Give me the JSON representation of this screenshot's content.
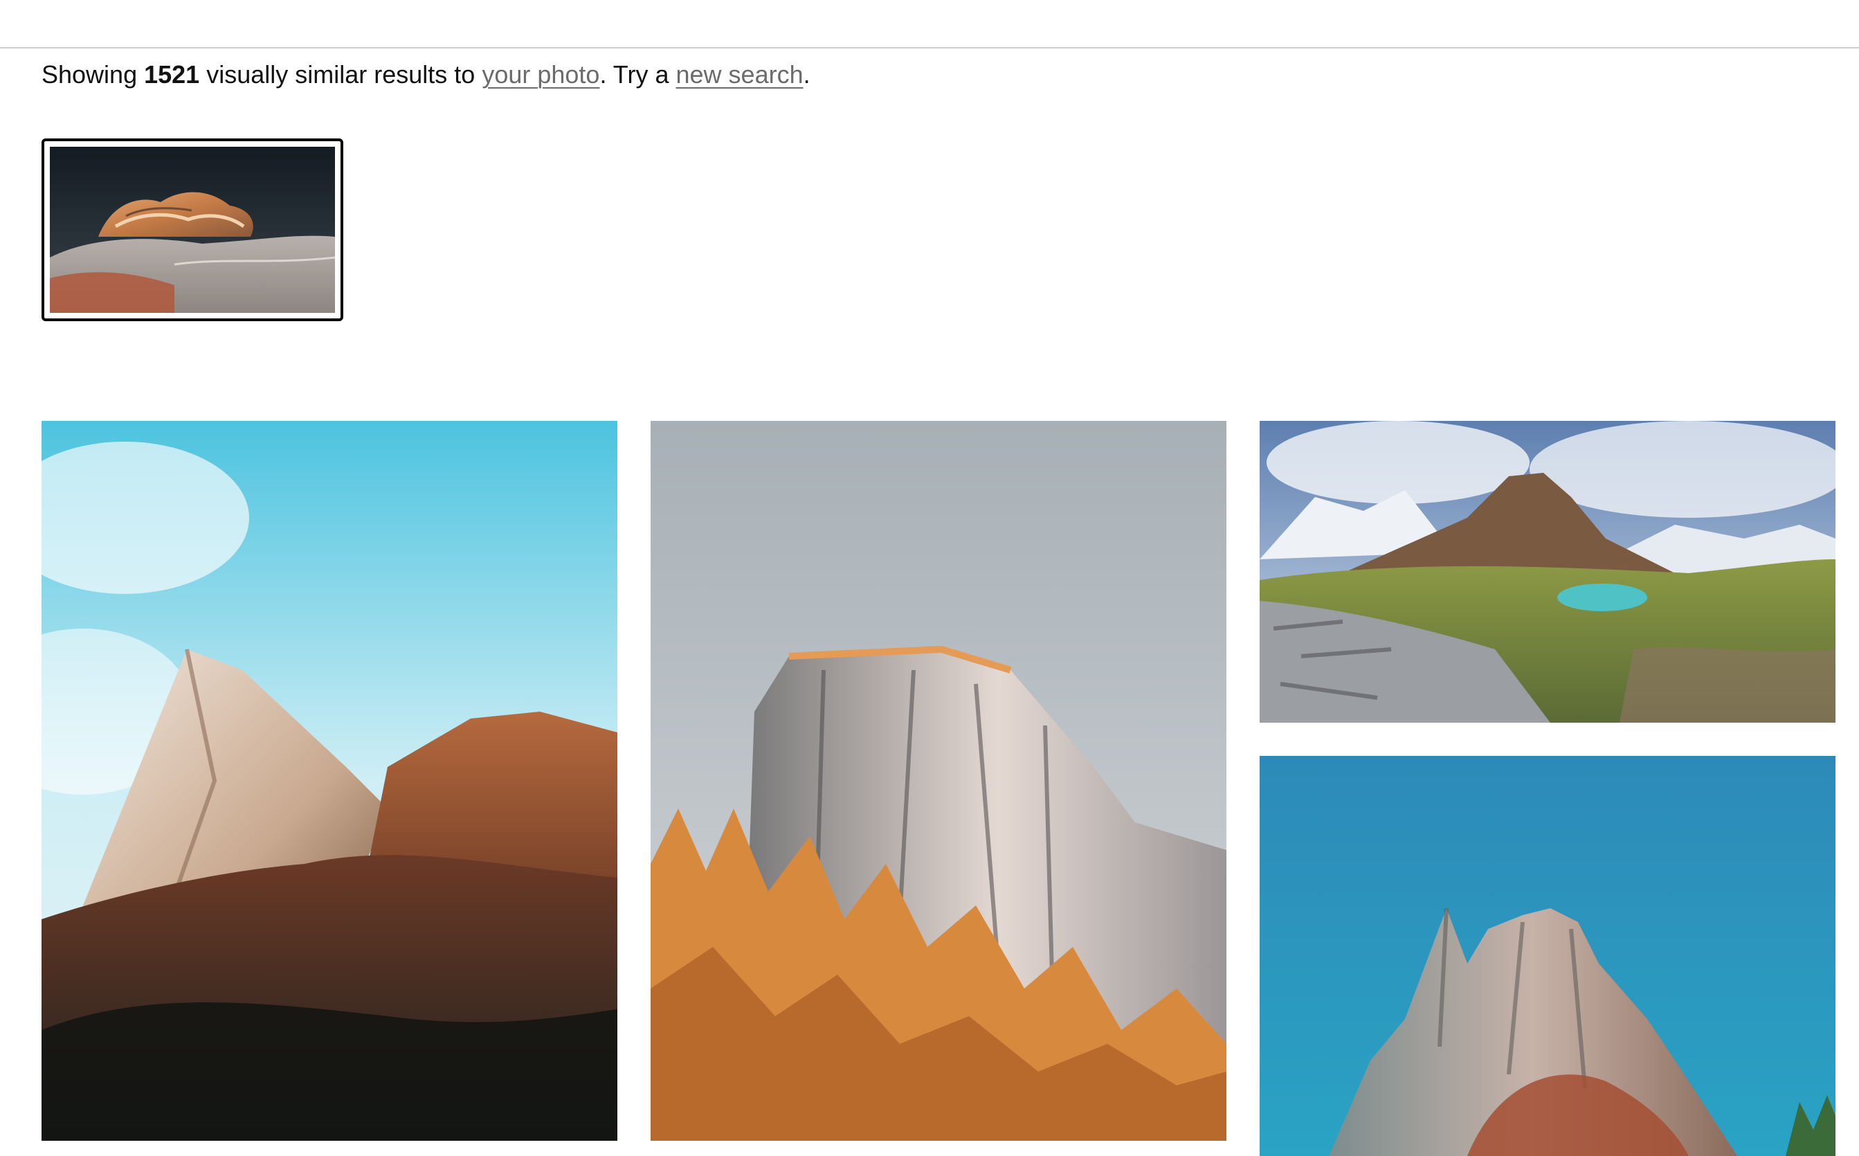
{
  "summary": {
    "prefix": "Showing",
    "count": "1521",
    "middle": "visually similar results to",
    "your_photo_link": "your photo",
    "try_text": ". Try a",
    "new_search_link": "new search",
    "suffix": "."
  },
  "colors": {
    "link": "#6b6b6b",
    "rule": "#cfcfcf",
    "thumb_border": "#000000"
  },
  "query_image": {
    "subject": "orange sandstone rock formation under dark sky"
  },
  "results": [
    {
      "subject": "foggy mountain peaks with autumn forest under blue sky"
    },
    {
      "subject": "rocky cliff with orange trees under grey sky"
    },
    {
      "subject": "alpine mountain with turquoise lake and snowy peaks"
    },
    {
      "subject": "jagged rock spire against blue sky"
    }
  ]
}
